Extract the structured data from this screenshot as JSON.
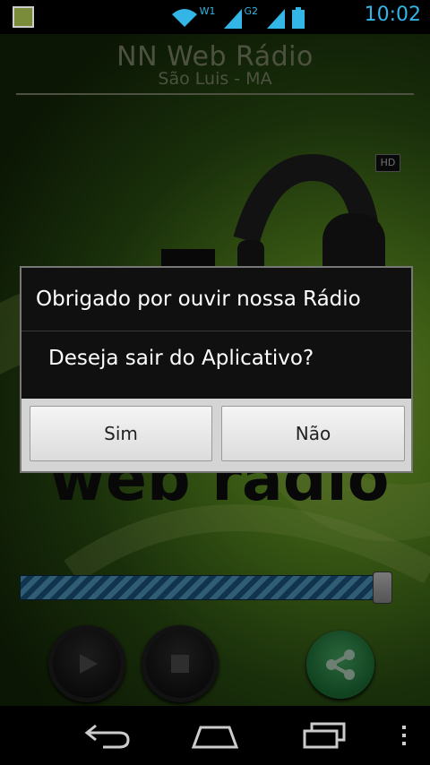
{
  "status_bar": {
    "time": "10:02",
    "wifi_label": "W1",
    "signal_label": "G2",
    "icons": [
      "app-icon",
      "wifi-icon",
      "signal-icon",
      "signal-icon",
      "battery-icon"
    ]
  },
  "header": {
    "title": "NN Web Rádio",
    "subtitle": "São Luis - MA"
  },
  "player": {
    "hd_badge": "HD",
    "volume_level": 0.97,
    "controls": [
      "play-icon",
      "stop-icon",
      "share-icon"
    ]
  },
  "dialog": {
    "title": "Obrigado por ouvir nossa Rádio",
    "message": "Deseja sair do Aplicativo?",
    "buttons": {
      "yes": "Sim",
      "no": "Não"
    }
  },
  "nav_bar": {
    "items": [
      "back-icon",
      "home-icon",
      "recent-apps-icon",
      "overflow-menu-icon"
    ]
  },
  "colors": {
    "accent": "#33b5e5",
    "background_green": "#6aa526",
    "slider_blue": "#2d7fb5",
    "share_green": "#2f9c52"
  }
}
